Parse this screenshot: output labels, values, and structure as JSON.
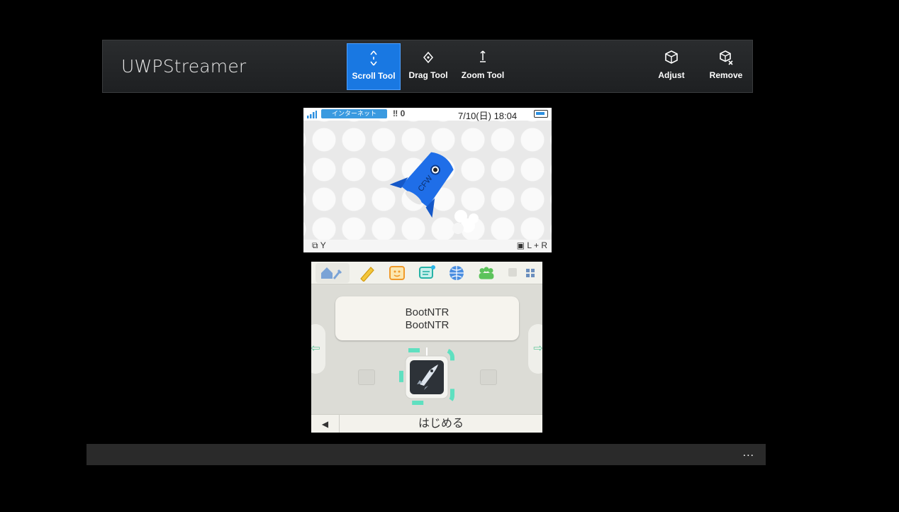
{
  "app": {
    "title": "UWPStreamer"
  },
  "toolbar": {
    "tools": [
      {
        "label": "Scroll Tool",
        "icon": "scroll-icon",
        "active": true
      },
      {
        "label": "Drag Tool",
        "icon": "drag-icon",
        "active": false
      },
      {
        "label": "Zoom Tool",
        "icon": "zoom-icon",
        "active": false
      }
    ],
    "actions": [
      {
        "label": "Adjust",
        "icon": "adjust-icon"
      },
      {
        "label": "Remove",
        "icon": "remove-icon"
      }
    ],
    "accent_color": "#1978e2"
  },
  "top_screen": {
    "network_label": "インターネット",
    "step_count": "0",
    "datetime": "7/10(日) 18:04",
    "hint_left": "Y",
    "hint_right": "L + R",
    "rocket_text": "CFW"
  },
  "bottom_screen": {
    "app_name_line1": "BootNTR",
    "app_name_line2": "BootNTR",
    "start_label": "はじめる",
    "back_label": "◀",
    "left_arrow": "⇦",
    "right_arrow": "⇨"
  },
  "bottom_bar": {
    "more_label": "..."
  }
}
